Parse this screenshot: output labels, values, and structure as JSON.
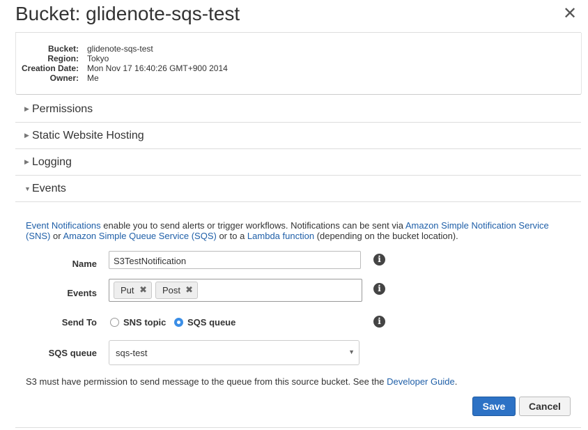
{
  "header": {
    "title": "Bucket: glidenote-sqs-test",
    "close_label": "✕"
  },
  "properties": [
    {
      "label": "Bucket:",
      "value": "glidenote-sqs-test"
    },
    {
      "label": "Region:",
      "value": "Tokyo"
    },
    {
      "label": "Creation Date:",
      "value": "Mon Nov 17 16:40:26 GMT+900 2014"
    },
    {
      "label": "Owner:",
      "value": "Me"
    }
  ],
  "sections": {
    "permissions": "Permissions",
    "static_website_hosting": "Static Website Hosting",
    "logging": "Logging",
    "events": "Events"
  },
  "events": {
    "desc": {
      "link1": "Event Notifications",
      "t1": " enable you to send alerts or trigger workflows. Notifications can be sent via ",
      "link2": "Amazon Simple Notification Service (SNS)",
      "t2": " or ",
      "link3": "Amazon Simple Queue Service (SQS)",
      "t3": " or to a ",
      "link4": "Lambda function",
      "t4": " (depending on the bucket location)."
    },
    "name_label": "Name",
    "name_value": "S3TestNotification",
    "events_label": "Events",
    "event_tags": [
      "Put",
      "Post"
    ],
    "tag_remove": "✖",
    "send_to_label": "Send To",
    "send_to_options": [
      "SNS topic",
      "SQS queue"
    ],
    "send_to_selected": "SQS queue",
    "sqs_label": "SQS queue",
    "sqs_value": "sqs-test",
    "note_text": "S3 must have permission to send message to the queue from this source bucket. See the ",
    "note_link": "Developer Guide",
    "note_end": ".",
    "save_label": "Save",
    "cancel_label": "Cancel",
    "info_glyph": "i"
  },
  "icons": {
    "close": "close-icon",
    "expand": "triangle-right-icon",
    "collapse": "triangle-down-icon",
    "info": "info-icon",
    "dropdown": "chevron-down-icon"
  },
  "colors": {
    "link": "#1f5fa8",
    "primary_button": "#2d72c5",
    "radio_selected": "#3b8ee6"
  }
}
